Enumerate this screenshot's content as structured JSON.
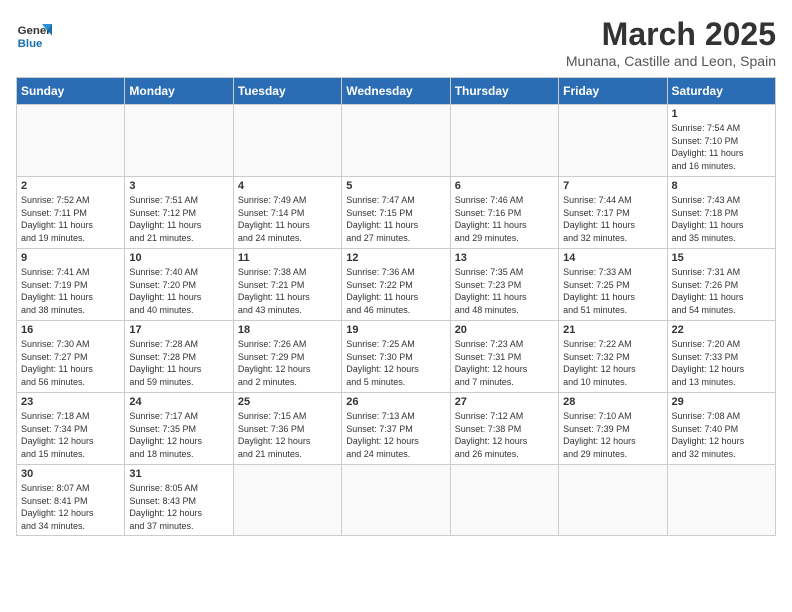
{
  "logo": {
    "text_general": "General",
    "text_blue": "Blue"
  },
  "header": {
    "title": "March 2025",
    "subtitle": "Munana, Castille and Leon, Spain"
  },
  "weekdays": [
    "Sunday",
    "Monday",
    "Tuesday",
    "Wednesday",
    "Thursday",
    "Friday",
    "Saturday"
  ],
  "weeks": [
    [
      {
        "day": "",
        "info": ""
      },
      {
        "day": "",
        "info": ""
      },
      {
        "day": "",
        "info": ""
      },
      {
        "day": "",
        "info": ""
      },
      {
        "day": "",
        "info": ""
      },
      {
        "day": "",
        "info": ""
      },
      {
        "day": "1",
        "info": "Sunrise: 7:54 AM\nSunset: 7:10 PM\nDaylight: 11 hours\nand 16 minutes."
      }
    ],
    [
      {
        "day": "2",
        "info": "Sunrise: 7:52 AM\nSunset: 7:11 PM\nDaylight: 11 hours\nand 19 minutes."
      },
      {
        "day": "3",
        "info": "Sunrise: 7:51 AM\nSunset: 7:12 PM\nDaylight: 11 hours\nand 21 minutes."
      },
      {
        "day": "4",
        "info": "Sunrise: 7:49 AM\nSunset: 7:14 PM\nDaylight: 11 hours\nand 24 minutes."
      },
      {
        "day": "5",
        "info": "Sunrise: 7:47 AM\nSunset: 7:15 PM\nDaylight: 11 hours\nand 27 minutes."
      },
      {
        "day": "6",
        "info": "Sunrise: 7:46 AM\nSunset: 7:16 PM\nDaylight: 11 hours\nand 29 minutes."
      },
      {
        "day": "7",
        "info": "Sunrise: 7:44 AM\nSunset: 7:17 PM\nDaylight: 11 hours\nand 32 minutes."
      },
      {
        "day": "8",
        "info": "Sunrise: 7:43 AM\nSunset: 7:18 PM\nDaylight: 11 hours\nand 35 minutes."
      }
    ],
    [
      {
        "day": "9",
        "info": "Sunrise: 7:41 AM\nSunset: 7:19 PM\nDaylight: 11 hours\nand 38 minutes."
      },
      {
        "day": "10",
        "info": "Sunrise: 7:40 AM\nSunset: 7:20 PM\nDaylight: 11 hours\nand 40 minutes."
      },
      {
        "day": "11",
        "info": "Sunrise: 7:38 AM\nSunset: 7:21 PM\nDaylight: 11 hours\nand 43 minutes."
      },
      {
        "day": "12",
        "info": "Sunrise: 7:36 AM\nSunset: 7:22 PM\nDaylight: 11 hours\nand 46 minutes."
      },
      {
        "day": "13",
        "info": "Sunrise: 7:35 AM\nSunset: 7:23 PM\nDaylight: 11 hours\nand 48 minutes."
      },
      {
        "day": "14",
        "info": "Sunrise: 7:33 AM\nSunset: 7:25 PM\nDaylight: 11 hours\nand 51 minutes."
      },
      {
        "day": "15",
        "info": "Sunrise: 7:31 AM\nSunset: 7:26 PM\nDaylight: 11 hours\nand 54 minutes."
      }
    ],
    [
      {
        "day": "16",
        "info": "Sunrise: 7:30 AM\nSunset: 7:27 PM\nDaylight: 11 hours\nand 56 minutes."
      },
      {
        "day": "17",
        "info": "Sunrise: 7:28 AM\nSunset: 7:28 PM\nDaylight: 11 hours\nand 59 minutes."
      },
      {
        "day": "18",
        "info": "Sunrise: 7:26 AM\nSunset: 7:29 PM\nDaylight: 12 hours\nand 2 minutes."
      },
      {
        "day": "19",
        "info": "Sunrise: 7:25 AM\nSunset: 7:30 PM\nDaylight: 12 hours\nand 5 minutes."
      },
      {
        "day": "20",
        "info": "Sunrise: 7:23 AM\nSunset: 7:31 PM\nDaylight: 12 hours\nand 7 minutes."
      },
      {
        "day": "21",
        "info": "Sunrise: 7:22 AM\nSunset: 7:32 PM\nDaylight: 12 hours\nand 10 minutes."
      },
      {
        "day": "22",
        "info": "Sunrise: 7:20 AM\nSunset: 7:33 PM\nDaylight: 12 hours\nand 13 minutes."
      }
    ],
    [
      {
        "day": "23",
        "info": "Sunrise: 7:18 AM\nSunset: 7:34 PM\nDaylight: 12 hours\nand 15 minutes."
      },
      {
        "day": "24",
        "info": "Sunrise: 7:17 AM\nSunset: 7:35 PM\nDaylight: 12 hours\nand 18 minutes."
      },
      {
        "day": "25",
        "info": "Sunrise: 7:15 AM\nSunset: 7:36 PM\nDaylight: 12 hours\nand 21 minutes."
      },
      {
        "day": "26",
        "info": "Sunrise: 7:13 AM\nSunset: 7:37 PM\nDaylight: 12 hours\nand 24 minutes."
      },
      {
        "day": "27",
        "info": "Sunrise: 7:12 AM\nSunset: 7:38 PM\nDaylight: 12 hours\nand 26 minutes."
      },
      {
        "day": "28",
        "info": "Sunrise: 7:10 AM\nSunset: 7:39 PM\nDaylight: 12 hours\nand 29 minutes."
      },
      {
        "day": "29",
        "info": "Sunrise: 7:08 AM\nSunset: 7:40 PM\nDaylight: 12 hours\nand 32 minutes."
      }
    ],
    [
      {
        "day": "30",
        "info": "Sunrise: 8:07 AM\nSunset: 8:41 PM\nDaylight: 12 hours\nand 34 minutes."
      },
      {
        "day": "31",
        "info": "Sunrise: 8:05 AM\nSunset: 8:43 PM\nDaylight: 12 hours\nand 37 minutes."
      },
      {
        "day": "",
        "info": ""
      },
      {
        "day": "",
        "info": ""
      },
      {
        "day": "",
        "info": ""
      },
      {
        "day": "",
        "info": ""
      },
      {
        "day": "",
        "info": ""
      }
    ]
  ]
}
